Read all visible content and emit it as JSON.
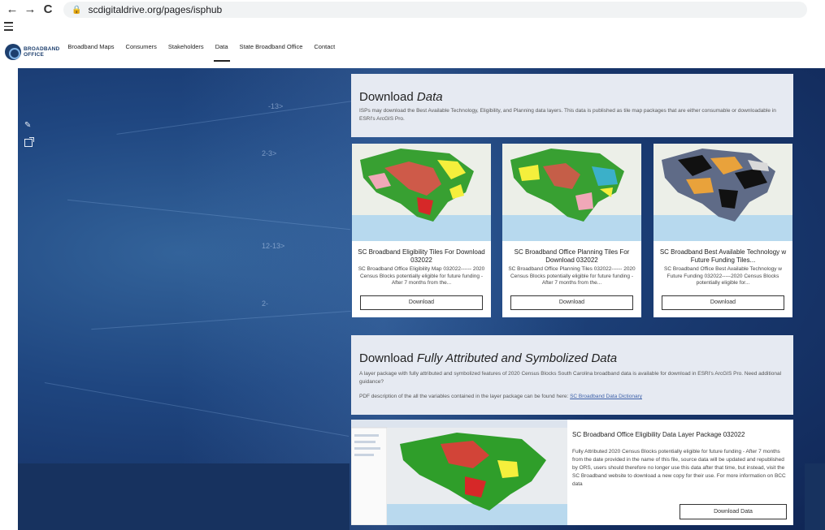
{
  "browser": {
    "url": "scdigitaldrive.org/pages/isphub",
    "back_glyph": "←",
    "forward_glyph": "→",
    "reload_glyph": "C",
    "lock_glyph": "🔒"
  },
  "site": {
    "logo_line1": "BROADBAND",
    "logo_line2": "OFFICE",
    "nav": [
      "Broadband Maps",
      "Consumers",
      "Stakeholders",
      "Data",
      "State Broadband Office",
      "Contact"
    ],
    "active_nav": "Data"
  },
  "hero": {
    "labels": [
      "-13>",
      "2-3>",
      "12-13>",
      "2-"
    ]
  },
  "download_data": {
    "heading": "Download",
    "heading_em": "Data",
    "description": "ISPs may download the Best Available Technology, Eligibility, and Planning data layers. This data is published as tile map packages that are either consumable or downloadable in ESRI's ArcGIS Pro."
  },
  "cards": [
    {
      "title": "SC Broadband Eligibility Tiles For Download 032022",
      "description": "SC Broadband Office Eligibility Map 032022------ 2020 Census Blocks potentially eligible for future funding - After 7 months from the...",
      "button": "Download",
      "icon": "eligibility-map-thumbnail"
    },
    {
      "title": "SC Broadband Office Planning Tiles For Download 032022",
      "description": "SC Broadband Office Planning Tiles 032022------ 2020 Census Blocks potentially eligible for future funding - After 7 months from the...",
      "button": "Download",
      "icon": "planning-map-thumbnail"
    },
    {
      "title": "SC Broadband Best Available Technology w Future Funding Tiles...",
      "description": "SC Broadband Office Best Available Technology w Future Funding 032022-----2020 Census Blocks potentially eligible for...",
      "button": "Download",
      "icon": "technology-map-thumbnail"
    }
  ],
  "attributed": {
    "heading": "Download",
    "heading_em": "Fully Attributed and Symbolized Data",
    "description": "A layer package with fully attributed and symbolized features of 2020 Census Blocks South Carolina broadband data is available for download in ESRI's ArcGIS Pro. Need additional guidance?",
    "pdf_text": "PDF description of the all the variables contained in the layer package can be found here:",
    "pdf_link": "SC Broadband Data Dictionary"
  },
  "package": {
    "title": "SC Broadband Office Eligibility Data Layer Package 032022",
    "description": "Fully Attributed 2020 Census Blocks potentially eligible for future funding - After 7 months from the date provided in the name of this file, source data will be updated and republished by ORS, users should therefore no longer use this data after that time, but instead, visit the SC Broadband website to download a new copy for their use. For more information on BCC data",
    "button": "Download Data"
  },
  "colors": {
    "panel": "#e6eaf2",
    "hero": "#1f4680",
    "link": "#3b5fa8"
  }
}
